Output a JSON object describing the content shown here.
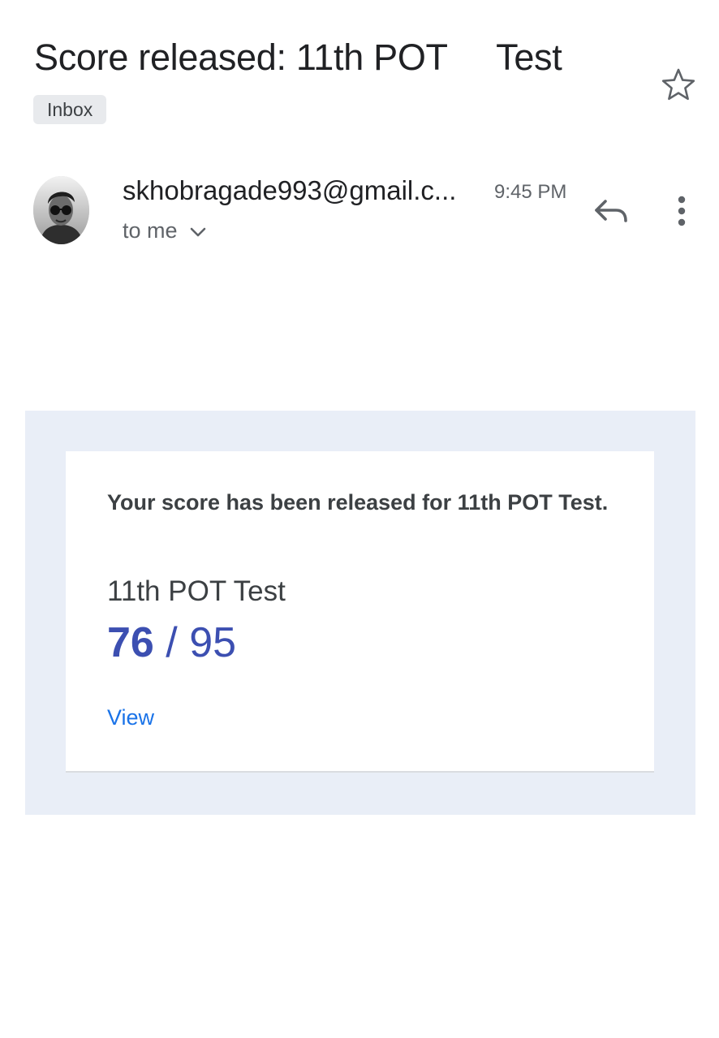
{
  "email": {
    "subject": "Score released: 11th POT     Test",
    "label": "Inbox",
    "sender": "skhobragade993@gmail.c...",
    "time": "9:45 PM",
    "recipient": "to me"
  },
  "icons": {
    "star": "star-outline-icon",
    "reply": "reply-icon",
    "more": "more-vert-icon",
    "expand": "chevron-down-icon"
  },
  "card": {
    "headline": "Your score has been released for 11th POT Test.",
    "test_name": "11th POT Test",
    "score_earned": "76",
    "score_separator": "/",
    "score_total": "95",
    "view_label": "View"
  },
  "colors": {
    "score": "#3c4fb1",
    "link": "#1a73e8",
    "frame_bg": "#e9eef7"
  }
}
